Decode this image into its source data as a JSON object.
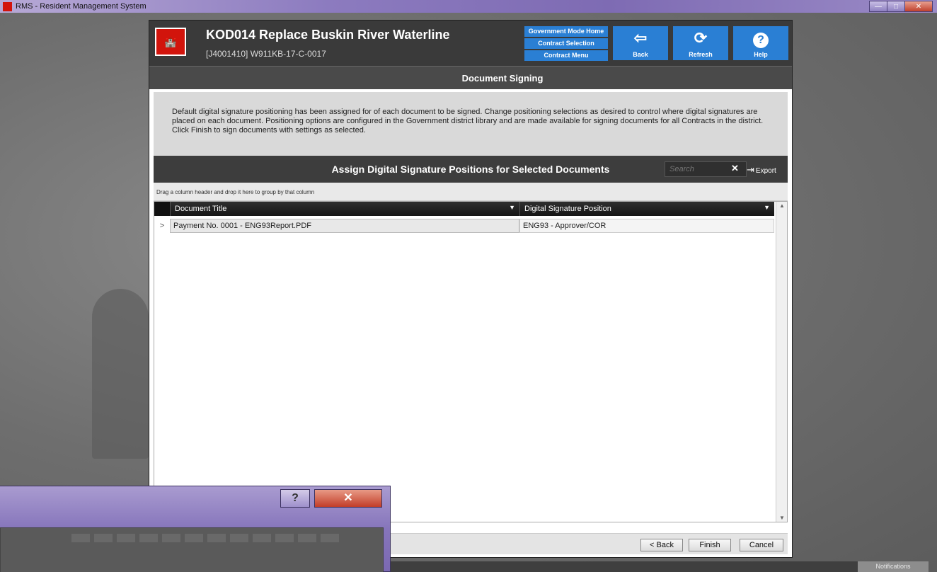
{
  "window": {
    "title": "RMS - Resident Management System",
    "min_glyph": "—",
    "max_glyph": "□",
    "close_glyph": "✕"
  },
  "header": {
    "logo_text": "🏰",
    "project_title": "KOD014 Replace Buskin River Waterline",
    "project_sub": "[J4001410] W911KB-17-C-0017",
    "nav_links": [
      "Government Mode Home",
      "Contract Selection",
      "Contract Menu"
    ],
    "buttons": {
      "back": {
        "icon": "⇦",
        "label": "Back"
      },
      "refresh": {
        "icon": "⟳",
        "label": "Refresh"
      },
      "help": {
        "icon": "?",
        "label": "Help"
      }
    }
  },
  "page": {
    "title": "Document Signing",
    "instructions": "Default digital signature positioning has been assigned for of each document to be signed. Change positioning selections as desired to control where digital signatures are placed on each document. Positioning options are configured in the Government district library and are made available for signing documents for all Contracts in the district. Click Finish to sign documents with settings as selected."
  },
  "grid": {
    "title": "Assign Digital Signature Positions for Selected Documents",
    "search_placeholder": "Search",
    "clear_glyph": "✕",
    "export_label": "Export",
    "group_hint": "Drag a column header and drop it here to group by that column",
    "columns": [
      "Document Title",
      "Digital Signature Position"
    ],
    "rows": [
      {
        "expander": ">",
        "document_title": "Payment No. 0001 - ENG93Report.PDF",
        "signature_position": "ENG93 - Approver/COR"
      }
    ]
  },
  "footer": {
    "back_label": "< Back",
    "finish_label": "Finish",
    "cancel_label": "Cancel"
  },
  "notifications_label": "Notifications",
  "dialog": {
    "help_glyph": "?",
    "close_glyph": "✕"
  }
}
